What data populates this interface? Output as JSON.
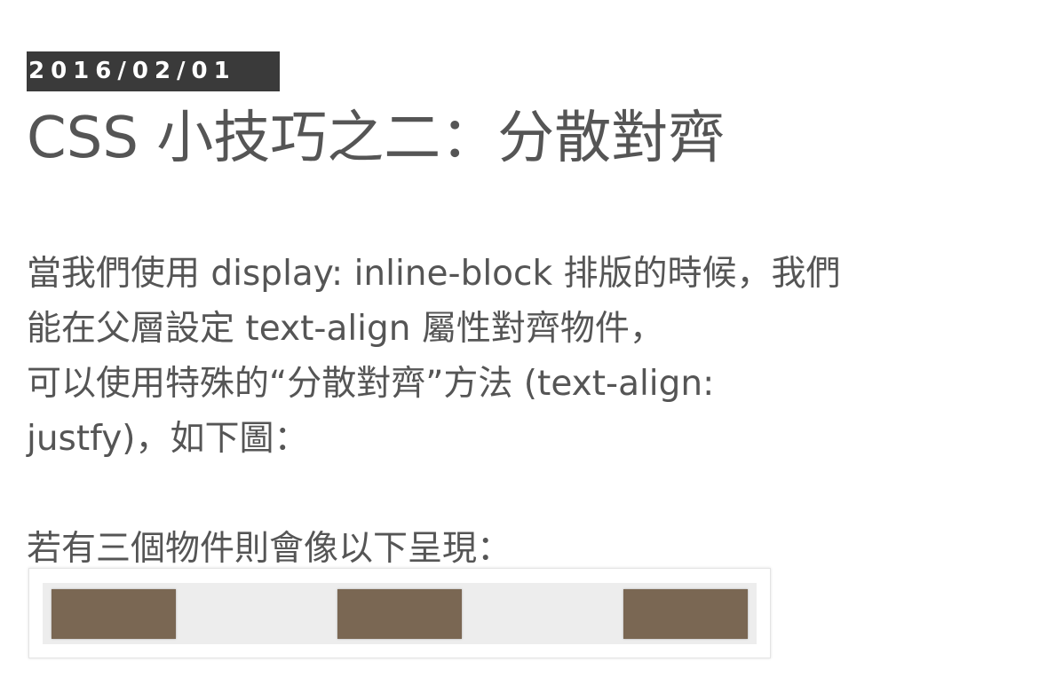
{
  "post": {
    "date": "2016/02/01",
    "title": "CSS 小技巧之二：分散對齊",
    "paragraph_lines": [
      "當我們使用 display: inline-block 排版的時候，我們",
      "能在父層設定 text-align 屬性對齊物件，",
      "可以使用特殊的“分散對齊”方法 (text-align:",
      "justfy)，如下圖："
    ],
    "caption": "若有三個物件則會像以下呈現："
  },
  "figure": {
    "item_count": 3,
    "item_color": "#7a6753",
    "container_color": "#ededed"
  }
}
